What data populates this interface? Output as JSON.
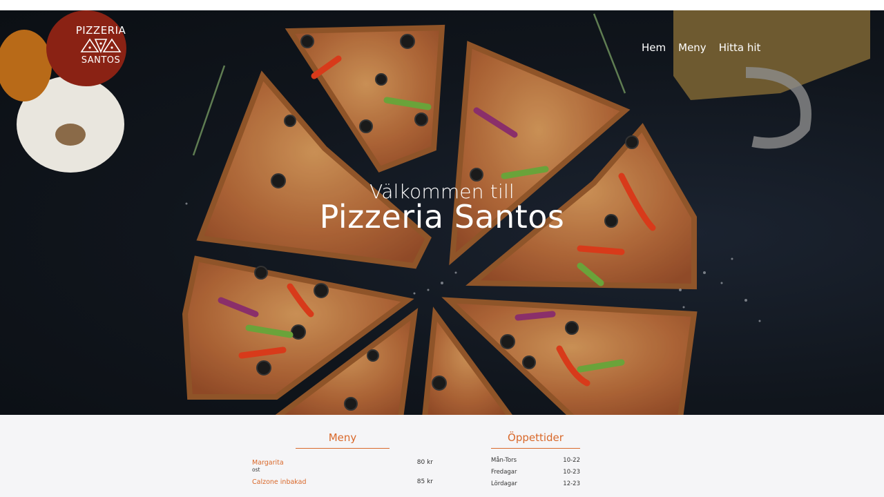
{
  "brand": {
    "line1": "PIZZERIA",
    "line2": "SANTOS"
  },
  "nav": {
    "items": [
      {
        "label": "Hem"
      },
      {
        "label": "Meny"
      },
      {
        "label": "Hitta hit"
      }
    ]
  },
  "hero": {
    "subtitle": "Välkommen till",
    "title": "Pizzeria Santos"
  },
  "menu": {
    "heading": "Meny",
    "items": [
      {
        "name": "Margarita",
        "desc": "ost",
        "price": "80 kr"
      },
      {
        "name": "Calzone inbakad",
        "desc": "",
        "price": "85 kr"
      }
    ]
  },
  "hours": {
    "heading": "Öppettider",
    "rows": [
      {
        "day": "Mån-Tors",
        "time": "10-22"
      },
      {
        "day": "Fredagar",
        "time": "10-23"
      },
      {
        "day": "Lördagar",
        "time": "12-23"
      }
    ]
  },
  "colors": {
    "accent": "#d9682a",
    "hero_bg": "#10151c",
    "lower_bg": "#f5f5f7"
  }
}
